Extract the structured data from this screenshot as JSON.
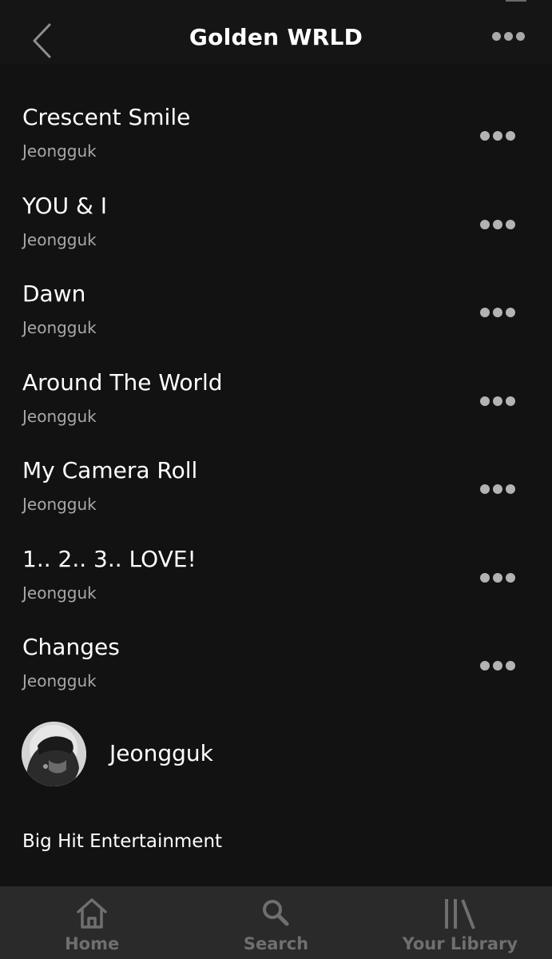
{
  "header": {
    "title": "Golden WRLD",
    "back_icon": "chevron-left-icon",
    "more_icon": "more-horizontal-icon"
  },
  "tracks": [
    {
      "title": "Crescent Smile",
      "artist": "Jeongguk"
    },
    {
      "title": "YOU & I",
      "artist": "Jeongguk"
    },
    {
      "title": "Dawn",
      "artist": "Jeongguk"
    },
    {
      "title": "Around The World",
      "artist": "Jeongguk"
    },
    {
      "title": "My Camera Roll",
      "artist": "Jeongguk"
    },
    {
      "title": "1.. 2.. 3.. LOVE!",
      "artist": "Jeongguk"
    },
    {
      "title": "Changes",
      "artist": "Jeongguk"
    }
  ],
  "artist": {
    "name": "Jeongguk",
    "avatar_icon": "artist-avatar"
  },
  "label": "Big Hit Entertainment",
  "bottom_nav": [
    {
      "label": "Home",
      "icon": "home-icon"
    },
    {
      "label": "Search",
      "icon": "search-icon"
    },
    {
      "label": "Your Library",
      "icon": "library-icon"
    }
  ],
  "colors": {
    "background": "#121212",
    "header": "#151515",
    "nav_bar": "#2a2a2a",
    "secondary_text": "#a7a7a7",
    "nav_text": "#6f6f6f",
    "dots": "#b3b3b3"
  }
}
